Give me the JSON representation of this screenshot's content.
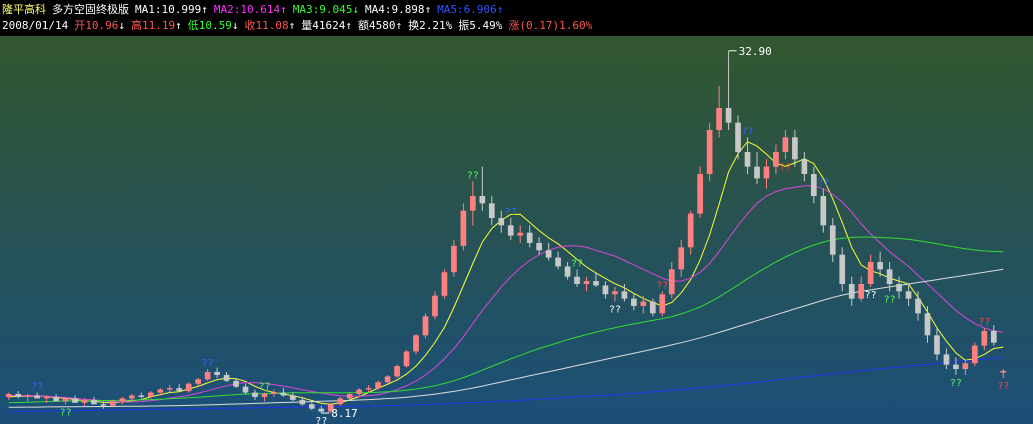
{
  "header": {
    "stock_name": "隆平高科",
    "indicator_name": "多方空固终极版",
    "ma1": {
      "label": "MA1:10.999",
      "arrow": "↑",
      "color": "#ffffff"
    },
    "ma2": {
      "label": "MA2:10.614",
      "arrow": "↑",
      "color": "#ff33ff"
    },
    "ma3": {
      "label": "MA3:9.045",
      "arrow": "↓",
      "color": "#33ff33"
    },
    "ma4": {
      "label": "MA4:9.898",
      "arrow": "↑",
      "color": "#ffffff"
    },
    "ma5": {
      "label": "MA5:6.906",
      "arrow": "↑",
      "color": "#3355ff"
    }
  },
  "quote": {
    "date": "2008/01/14",
    "open_label": "开",
    "open": "10.96",
    "open_arrow": "↓",
    "high_label": "高",
    "high": "11.19",
    "high_arrow": "↑",
    "low_label": "低",
    "low": "10.59",
    "low_arrow": "↓",
    "close_label": "收",
    "close": "11.08",
    "close_arrow": "↑",
    "volume": "量41624",
    "volume_arrow": "↑",
    "amount": "额4580",
    "amount_arrow": "↑",
    "turnover": "换2.21%",
    "amplitude": "振5.49%",
    "change": "涨(0.17)1.60%"
  },
  "colors": {
    "bg_top": "#32562e",
    "bg_bottom": "#1b4f79",
    "up_candle": "#ff8080",
    "down_candle": "#c8c8c8",
    "ma_yellow": "#ffff33",
    "ma_magenta": "#dd44dd",
    "ma_green": "#33dd33",
    "ma_white": "#dddddd",
    "ma_blue": "#2233ee",
    "label_qq_green": "#55ff55",
    "label_qq_red": "#ff4444",
    "label_qq_blue": "#3366ff",
    "label_qq_white": "#ffffff"
  },
  "chart_data": {
    "type": "candlestick",
    "ylim": [
      8.0,
      33.5
    ],
    "max_price_label": "32.90",
    "min_price_label": "8.17",
    "signal_text": "??",
    "candles": [
      [
        9.3,
        9.6,
        9.1,
        9.5
      ],
      [
        9.5,
        9.7,
        9.2,
        9.3
      ],
      [
        9.3,
        9.5,
        9.0,
        9.4
      ],
      [
        9.4,
        9.6,
        9.2,
        9.2
      ],
      [
        9.2,
        9.4,
        8.9,
        9.3
      ],
      [
        9.3,
        9.5,
        9.1,
        9.0
      ],
      [
        9.0,
        9.3,
        8.8,
        9.2
      ],
      [
        9.2,
        9.4,
        9.0,
        8.9
      ],
      [
        8.9,
        9.2,
        8.7,
        9.1
      ],
      [
        9.1,
        9.3,
        8.8,
        8.8
      ],
      [
        8.8,
        9.0,
        8.5,
        8.7
      ],
      [
        8.7,
        9.1,
        8.6,
        9.0
      ],
      [
        9.0,
        9.3,
        8.8,
        9.2
      ],
      [
        9.2,
        9.5,
        9.0,
        9.4
      ],
      [
        9.4,
        9.6,
        9.2,
        9.3
      ],
      [
        9.3,
        9.7,
        9.2,
        9.6
      ],
      [
        9.6,
        9.9,
        9.4,
        9.8
      ],
      [
        9.8,
        10.1,
        9.6,
        9.9
      ],
      [
        9.9,
        10.2,
        9.7,
        9.7
      ],
      [
        9.7,
        10.3,
        9.6,
        10.2
      ],
      [
        10.2,
        10.6,
        10.0,
        10.5
      ],
      [
        10.5,
        11.2,
        10.4,
        11.0
      ],
      [
        11.0,
        11.3,
        10.6,
        10.8
      ],
      [
        10.8,
        11.0,
        10.3,
        10.4
      ],
      [
        10.4,
        10.6,
        9.9,
        10.0
      ],
      [
        10.0,
        10.2,
        9.5,
        9.6
      ],
      [
        9.6,
        9.8,
        9.1,
        9.3
      ],
      [
        9.3,
        9.6,
        9.0,
        9.5
      ],
      [
        9.5,
        9.8,
        9.3,
        9.6
      ],
      [
        9.6,
        9.9,
        9.3,
        9.4
      ],
      [
        9.4,
        9.6,
        9.0,
        9.1
      ],
      [
        9.1,
        9.3,
        8.7,
        8.8
      ],
      [
        8.8,
        9.0,
        8.4,
        8.5
      ],
      [
        8.5,
        8.7,
        8.2,
        8.3
      ],
      [
        8.3,
        8.9,
        8.2,
        8.8
      ],
      [
        8.8,
        9.3,
        8.7,
        9.2
      ],
      [
        9.2,
        9.6,
        9.1,
        9.5
      ],
      [
        9.5,
        9.9,
        9.4,
        9.8
      ],
      [
        9.8,
        10.1,
        9.6,
        9.9
      ],
      [
        9.9,
        10.4,
        9.8,
        10.3
      ],
      [
        10.3,
        10.8,
        10.2,
        10.7
      ],
      [
        10.7,
        11.5,
        10.6,
        11.4
      ],
      [
        11.4,
        12.5,
        11.3,
        12.4
      ],
      [
        12.4,
        13.6,
        12.2,
        13.5
      ],
      [
        13.5,
        15.0,
        13.3,
        14.8
      ],
      [
        14.8,
        16.5,
        14.6,
        16.2
      ],
      [
        16.2,
        18.0,
        16.0,
        17.8
      ],
      [
        17.8,
        20.0,
        17.5,
        19.6
      ],
      [
        19.6,
        22.5,
        19.3,
        22.0
      ],
      [
        22.0,
        24.0,
        21.0,
        23.0
      ],
      [
        23.0,
        25.0,
        22.0,
        22.5
      ],
      [
        22.5,
        23.0,
        21.0,
        21.5
      ],
      [
        21.5,
        22.0,
        20.5,
        21.0
      ],
      [
        21.0,
        21.5,
        20.0,
        20.3
      ],
      [
        20.3,
        21.0,
        19.8,
        20.5
      ],
      [
        20.5,
        21.0,
        19.5,
        19.8
      ],
      [
        19.8,
        20.2,
        19.0,
        19.3
      ],
      [
        19.3,
        19.8,
        18.6,
        18.8
      ],
      [
        18.8,
        19.2,
        18.0,
        18.2
      ],
      [
        18.2,
        18.5,
        17.3,
        17.5
      ],
      [
        17.5,
        18.0,
        16.8,
        17.0
      ],
      [
        17.0,
        17.5,
        16.5,
        17.2
      ],
      [
        17.2,
        17.8,
        16.8,
        16.9
      ],
      [
        16.9,
        17.2,
        16.0,
        16.3
      ],
      [
        16.3,
        16.8,
        15.8,
        16.5
      ],
      [
        16.5,
        17.0,
        15.8,
        16.0
      ],
      [
        16.0,
        16.3,
        15.2,
        15.5
      ],
      [
        15.5,
        16.2,
        15.0,
        15.8
      ],
      [
        15.8,
        16.0,
        14.8,
        15.0
      ],
      [
        15.0,
        16.5,
        14.8,
        16.3
      ],
      [
        16.3,
        18.5,
        16.0,
        18.0
      ],
      [
        18.0,
        20.0,
        17.5,
        19.5
      ],
      [
        19.5,
        22.0,
        19.0,
        21.8
      ],
      [
        21.8,
        25.0,
        21.5,
        24.5
      ],
      [
        24.5,
        28.0,
        24.0,
        27.5
      ],
      [
        27.5,
        30.5,
        27.0,
        29.0
      ],
      [
        29.0,
        32.9,
        27.5,
        28.0
      ],
      [
        28.0,
        28.5,
        25.5,
        26.0
      ],
      [
        26.0,
        27.0,
        24.5,
        25.0
      ],
      [
        25.0,
        26.0,
        23.8,
        24.2
      ],
      [
        24.2,
        25.5,
        23.5,
        25.0
      ],
      [
        25.0,
        26.5,
        24.5,
        26.0
      ],
      [
        26.0,
        27.5,
        25.5,
        27.0
      ],
      [
        27.0,
        27.5,
        25.0,
        25.5
      ],
      [
        25.5,
        26.0,
        24.0,
        24.5
      ],
      [
        24.5,
        25.0,
        22.5,
        23.0
      ],
      [
        23.0,
        23.5,
        20.5,
        21.0
      ],
      [
        21.0,
        21.5,
        18.5,
        19.0
      ],
      [
        19.0,
        19.5,
        16.5,
        17.0
      ],
      [
        17.0,
        17.5,
        15.5,
        16.0
      ],
      [
        16.0,
        17.5,
        15.8,
        17.0
      ],
      [
        17.0,
        19.0,
        16.8,
        18.5
      ],
      [
        18.5,
        19.2,
        17.5,
        18.0
      ],
      [
        18.0,
        18.5,
        16.5,
        17.0
      ],
      [
        17.0,
        17.5,
        16.0,
        16.5
      ],
      [
        16.5,
        17.0,
        15.5,
        16.0
      ],
      [
        16.0,
        16.5,
        14.5,
        15.0
      ],
      [
        15.0,
        15.5,
        13.0,
        13.5
      ],
      [
        13.5,
        14.0,
        11.8,
        12.2
      ],
      [
        12.2,
        12.6,
        11.2,
        11.5
      ],
      [
        11.5,
        12.0,
        10.8,
        11.2
      ],
      [
        11.2,
        11.8,
        10.8,
        11.6
      ],
      [
        11.6,
        13.0,
        11.4,
        12.8
      ],
      [
        12.8,
        14.0,
        12.5,
        13.8
      ],
      [
        13.8,
        14.2,
        12.8,
        13.0
      ],
      [
        10.96,
        11.19,
        10.59,
        11.08
      ]
    ],
    "series": [
      {
        "name": "MA1",
        "color": "#ffff33",
        "values": [
          9.3,
          9.35,
          9.37,
          9.34,
          9.34,
          9.24,
          9.22,
          9.12,
          9.04,
          9.0,
          8.92,
          8.9,
          8.96,
          9.04,
          9.12,
          9.3,
          9.46,
          9.6,
          9.66,
          9.84,
          10.02,
          10.26,
          10.48,
          10.58,
          10.54,
          10.36,
          10.02,
          9.76,
          9.6,
          9.5,
          9.38,
          9.24,
          9.06,
          8.86,
          8.8,
          8.9,
          9.1,
          9.32,
          9.6,
          9.9,
          10.16,
          10.46,
          10.86,
          11.4,
          12.14,
          13.02,
          14.04,
          15.4,
          16.9,
          18.4,
          19.86,
          20.78,
          21.36,
          21.74,
          21.76,
          21.2,
          20.64,
          20.14,
          19.74,
          19.22,
          18.68,
          18.16,
          17.74,
          17.38,
          17.02,
          16.74,
          16.36,
          16.02,
          15.74,
          15.5,
          15.74,
          16.4,
          17.3,
          18.66,
          20.34,
          22.44,
          24.64,
          25.9,
          26.7,
          26.4,
          25.84,
          25.24,
          25.02,
          25.26,
          25.54,
          25.2,
          24.2,
          22.8,
          21.2,
          19.5,
          18.3,
          17.9,
          17.7,
          17.4,
          17.2,
          17.0,
          16.1,
          15.1,
          14.0,
          13.1,
          12.3,
          11.8,
          11.9,
          12.2,
          12.6,
          12.7
        ]
      },
      {
        "name": "MA2",
        "color": "#dd44dd",
        "values": [
          9.4,
          9.4,
          9.4,
          9.38,
          9.36,
          9.3,
          9.26,
          9.2,
          9.14,
          9.1,
          9.04,
          8.98,
          8.96,
          8.96,
          8.98,
          9.04,
          9.12,
          9.22,
          9.3,
          9.42,
          9.56,
          9.72,
          9.9,
          10.06,
          10.2,
          10.28,
          10.28,
          10.22,
          10.14,
          10.04,
          9.92,
          9.8,
          9.68,
          9.56,
          9.46,
          9.38,
          9.34,
          9.34,
          9.38,
          9.46,
          9.6,
          9.8,
          10.06,
          10.38,
          10.8,
          11.3,
          11.9,
          12.6,
          13.4,
          14.3,
          15.2,
          16.0,
          16.8,
          17.5,
          18.1,
          18.6,
          19.0,
          19.3,
          19.5,
          19.6,
          19.6,
          19.5,
          19.3,
          19.1,
          18.9,
          18.6,
          18.3,
          18.0,
          17.7,
          17.4,
          17.2,
          17.2,
          17.4,
          17.8,
          18.4,
          19.2,
          20.1,
          21.0,
          21.8,
          22.5,
          23.0,
          23.3,
          23.5,
          23.6,
          23.7,
          23.7,
          23.5,
          23.1,
          22.6,
          21.9,
          21.1,
          20.4,
          19.8,
          19.2,
          18.7,
          18.2,
          17.6,
          17.0,
          16.4,
          15.8,
          15.2,
          14.7,
          14.3,
          14.0,
          13.8,
          13.7
        ]
      },
      {
        "name": "MA3",
        "color": "#33dd33",
        "values": [
          8.9,
          8.92,
          8.94,
          8.96,
          8.98,
          9.0,
          9.02,
          9.03,
          9.04,
          9.05,
          9.06,
          9.06,
          9.07,
          9.08,
          9.1,
          9.12,
          9.15,
          9.18,
          9.21,
          9.24,
          9.28,
          9.32,
          9.37,
          9.42,
          9.46,
          9.49,
          9.51,
          9.53,
          9.55,
          9.57,
          9.58,
          9.59,
          9.59,
          9.59,
          9.58,
          9.58,
          9.58,
          9.59,
          9.6,
          9.62,
          9.65,
          9.7,
          9.76,
          9.84,
          9.94,
          10.06,
          10.22,
          10.4,
          10.62,
          10.86,
          11.12,
          11.38,
          11.64,
          11.9,
          12.14,
          12.38,
          12.6,
          12.8,
          13.0,
          13.2,
          13.38,
          13.56,
          13.72,
          13.88,
          14.02,
          14.16,
          14.28,
          14.4,
          14.52,
          14.64,
          14.78,
          14.96,
          15.18,
          15.44,
          15.76,
          16.12,
          16.52,
          16.94,
          17.36,
          17.76,
          18.14,
          18.5,
          18.84,
          19.14,
          19.42,
          19.66,
          19.86,
          20.02,
          20.12,
          20.18,
          20.2,
          20.2,
          20.18,
          20.14,
          20.1,
          20.04,
          19.96,
          19.86,
          19.74,
          19.62,
          19.5,
          19.4,
          19.32,
          19.26,
          19.22,
          19.2
        ]
      },
      {
        "name": "MA4",
        "color": "#dddddd",
        "values": [
          8.6,
          8.6,
          8.61,
          8.61,
          8.62,
          8.62,
          8.63,
          8.63,
          8.64,
          8.64,
          8.65,
          8.65,
          8.66,
          8.66,
          8.67,
          8.68,
          8.69,
          8.7,
          8.71,
          8.72,
          8.74,
          8.76,
          8.78,
          8.8,
          8.82,
          8.84,
          8.86,
          8.88,
          8.9,
          8.92,
          8.94,
          8.96,
          8.98,
          9.0,
          9.02,
          9.04,
          9.06,
          9.09,
          9.12,
          9.15,
          9.19,
          9.23,
          9.28,
          9.34,
          9.41,
          9.49,
          9.58,
          9.68,
          9.79,
          9.91,
          10.04,
          10.18,
          10.32,
          10.46,
          10.6,
          10.74,
          10.88,
          11.02,
          11.16,
          11.3,
          11.44,
          11.58,
          11.72,
          11.86,
          12.0,
          12.14,
          12.28,
          12.42,
          12.56,
          12.7,
          12.85,
          13.0,
          13.16,
          13.33,
          13.51,
          13.7,
          13.9,
          14.1,
          14.3,
          14.5,
          14.7,
          14.9,
          15.1,
          15.3,
          15.5,
          15.7,
          15.9,
          16.08,
          16.24,
          16.38,
          16.5,
          16.6,
          16.7,
          16.8,
          16.9,
          17.0,
          17.1,
          17.2,
          17.3,
          17.4,
          17.5,
          17.6,
          17.7,
          17.8,
          17.9,
          18.0
        ]
      },
      {
        "name": "MA5",
        "color": "#2233ee",
        "values": [
          8.3,
          8.31,
          8.32,
          8.33,
          8.34,
          8.35,
          8.36,
          8.37,
          8.38,
          8.39,
          8.4,
          8.41,
          8.42,
          8.43,
          8.44,
          8.45,
          8.46,
          8.47,
          8.48,
          8.49,
          8.5,
          8.51,
          8.52,
          8.53,
          8.54,
          8.55,
          8.56,
          8.57,
          8.58,
          8.59,
          8.6,
          8.61,
          8.62,
          8.63,
          8.64,
          8.65,
          8.66,
          8.67,
          8.68,
          8.69,
          8.7,
          8.72,
          8.74,
          8.76,
          8.78,
          8.8,
          8.83,
          8.86,
          8.89,
          8.92,
          8.95,
          8.98,
          9.01,
          9.04,
          9.07,
          9.1,
          9.14,
          9.18,
          9.22,
          9.26,
          9.3,
          9.34,
          9.38,
          9.42,
          9.46,
          9.5,
          9.55,
          9.6,
          9.65,
          9.7,
          9.75,
          9.8,
          9.86,
          9.92,
          9.98,
          10.04,
          10.1,
          10.17,
          10.24,
          10.31,
          10.38,
          10.45,
          10.52,
          10.59,
          10.66,
          10.73,
          10.8,
          10.87,
          10.94,
          11.01,
          11.08,
          11.15,
          11.22,
          11.28,
          11.34,
          11.4,
          11.46,
          11.52,
          11.58,
          11.64,
          11.7,
          11.76,
          11.82,
          11.88,
          11.94,
          12.0
        ]
      }
    ],
    "signals": [
      {
        "i": 3,
        "color": "label_qq_blue",
        "pos": "above"
      },
      {
        "i": 6,
        "color": "label_qq_green",
        "pos": "below"
      },
      {
        "i": 21,
        "color": "label_qq_blue",
        "pos": "above"
      },
      {
        "i": 27,
        "color": "label_qq_green",
        "pos": "above"
      },
      {
        "i": 33,
        "color": "label_qq_white",
        "pos": "below"
      },
      {
        "i": 49,
        "color": "label_qq_green",
        "pos": "above"
      },
      {
        "i": 53,
        "color": "label_qq_blue",
        "pos": "above"
      },
      {
        "i": 60,
        "color": "label_qq_green",
        "pos": "above"
      },
      {
        "i": 64,
        "color": "label_qq_white",
        "pos": "below"
      },
      {
        "i": 69,
        "color": "label_qq_red",
        "pos": "above"
      },
      {
        "i": 78,
        "color": "label_qq_blue",
        "pos": "above"
      },
      {
        "i": 82,
        "color": "label_qq_red",
        "pos": "below"
      },
      {
        "i": 86,
        "color": "label_qq_blue",
        "pos": "above"
      },
      {
        "i": 91,
        "color": "label_qq_white",
        "pos": "below"
      },
      {
        "i": 93,
        "color": "label_qq_green",
        "pos": "below"
      },
      {
        "i": 100,
        "color": "label_qq_green",
        "pos": "below"
      },
      {
        "i": 103,
        "color": "label_qq_red",
        "pos": "above"
      },
      {
        "i": 105,
        "color": "label_qq_red",
        "pos": "below"
      }
    ]
  }
}
